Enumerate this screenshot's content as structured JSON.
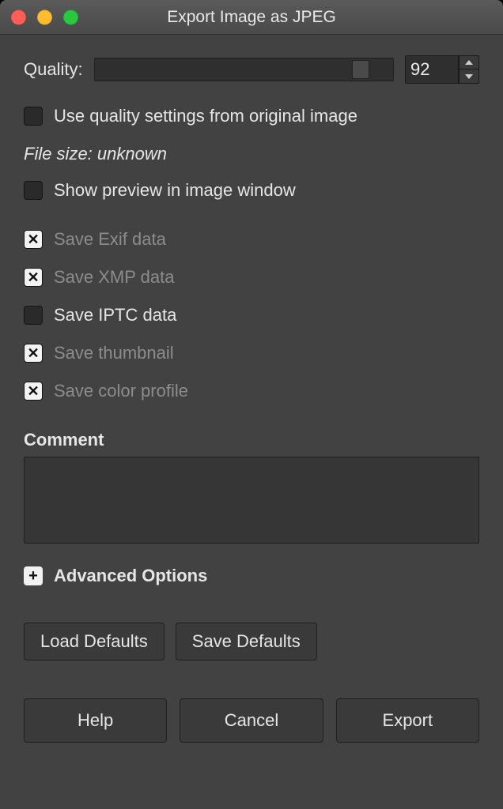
{
  "titlebar": {
    "title": "Export Image as JPEG"
  },
  "quality": {
    "label": "Quality:",
    "value": "92"
  },
  "checks": {
    "use_original_quality": {
      "label": "Use quality settings from original image",
      "checked": false,
      "disabled": false
    },
    "show_preview": {
      "label": "Show preview in image window",
      "checked": false,
      "disabled": false
    },
    "save_exif": {
      "label": "Save Exif data",
      "checked": true,
      "disabled": true
    },
    "save_xmp": {
      "label": "Save XMP data",
      "checked": true,
      "disabled": true
    },
    "save_iptc": {
      "label": "Save IPTC data",
      "checked": false,
      "disabled": false
    },
    "save_thumb": {
      "label": "Save thumbnail",
      "checked": true,
      "disabled": true
    },
    "save_color_profile": {
      "label": "Save color profile",
      "checked": true,
      "disabled": true
    }
  },
  "file_size": "File size: unknown",
  "comment": {
    "label": "Comment",
    "value": ""
  },
  "advanced": {
    "label": "Advanced Options"
  },
  "defaults": {
    "load": "Load Defaults",
    "save": "Save Defaults"
  },
  "actions": {
    "help": "Help",
    "cancel": "Cancel",
    "export": "Export"
  }
}
